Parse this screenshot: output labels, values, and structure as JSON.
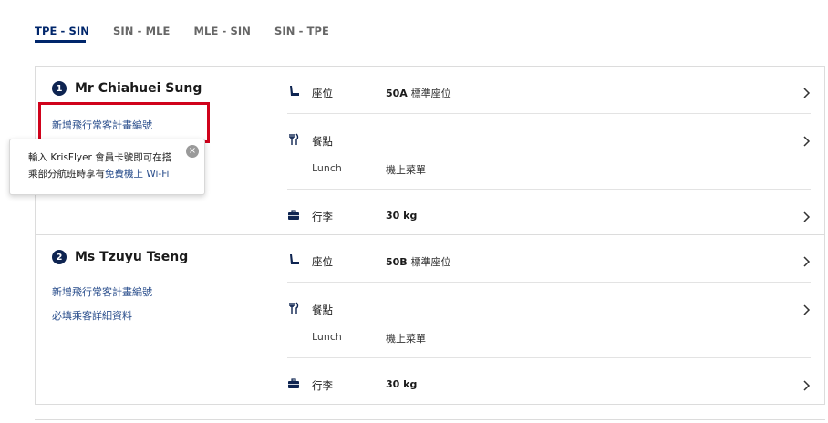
{
  "tabs": [
    {
      "label": "TPE - SIN",
      "active": true
    },
    {
      "label": "SIN - MLE",
      "active": false
    },
    {
      "label": "MLE - SIN",
      "active": false
    },
    {
      "label": "SIN - TPE",
      "active": false
    }
  ],
  "passengers": [
    {
      "number": "1",
      "name": "Mr Chiahuei Sung",
      "link_frequent_flyer": "新增飛行常客計畫編號",
      "seat": {
        "label": "座位",
        "value": "50A",
        "sub": "標準座位"
      },
      "meal": {
        "label": "餐點",
        "meal_type": "Lunch",
        "meal_value": "機上菜單"
      },
      "baggage": {
        "label": "行李",
        "value": "30 kg"
      }
    },
    {
      "number": "2",
      "name": "Ms Tzuyu Tseng",
      "link_frequent_flyer": "新增飛行常客計畫編號",
      "link_details": "必填乘客詳細資料",
      "seat": {
        "label": "座位",
        "value": "50B",
        "sub": "標準座位"
      },
      "meal": {
        "label": "餐點",
        "meal_type": "Lunch",
        "meal_value": "機上菜單"
      },
      "baggage": {
        "label": "行李",
        "value": "30 kg"
      }
    }
  ],
  "tooltip": {
    "text_line1": "輸入 KrisFlyer 會員卡號即可在搭",
    "text_line2_prefix": "乘部分航班時享有",
    "text_line2_link": "免費機上 Wi-Fi",
    "close_glyph": "×"
  },
  "colors": {
    "accent": "#00266b",
    "link": "#2a4e8c",
    "highlight": "#d0021b"
  },
  "icons": {
    "seat": "seat-icon",
    "meal": "cutlery-icon",
    "baggage": "suitcase-icon",
    "chevron": "chevron-right-icon",
    "close": "close-icon"
  }
}
